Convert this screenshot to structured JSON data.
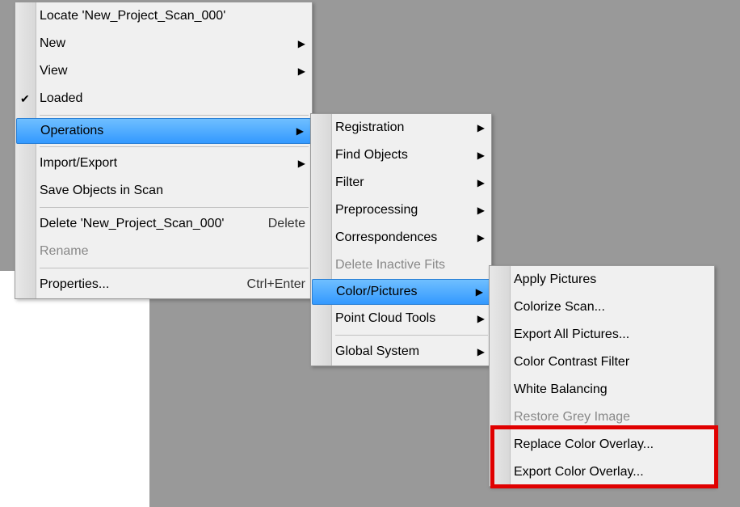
{
  "menu1": {
    "locate": "Locate 'New_Project_Scan_000'",
    "new": "New",
    "view": "View",
    "loaded": "Loaded",
    "operations": "Operations",
    "import_export": "Import/Export",
    "save_objects": "Save Objects in Scan",
    "delete": "Delete 'New_Project_Scan_000'",
    "delete_shortcut": "Delete",
    "rename": "Rename",
    "properties": "Properties...",
    "properties_shortcut": "Ctrl+Enter"
  },
  "menu2": {
    "registration": "Registration",
    "find_objects": "Find Objects",
    "filter": "Filter",
    "preprocessing": "Preprocessing",
    "correspondences": "Correspondences",
    "delete_inactive": "Delete Inactive Fits",
    "color_pictures": "Color/Pictures",
    "point_cloud_tools": "Point Cloud Tools",
    "global_system": "Global System"
  },
  "menu3": {
    "apply_pictures": "Apply Pictures",
    "colorize_scan": "Colorize Scan...",
    "export_all_pictures": "Export All Pictures...",
    "color_contrast": "Color Contrast Filter",
    "white_balancing": "White Balancing",
    "restore_grey": "Restore Grey Image",
    "replace_overlay": "Replace Color Overlay...",
    "export_overlay": "Export Color Overlay..."
  },
  "highlight_box_note": "red-box-around-replace-export-overlay"
}
